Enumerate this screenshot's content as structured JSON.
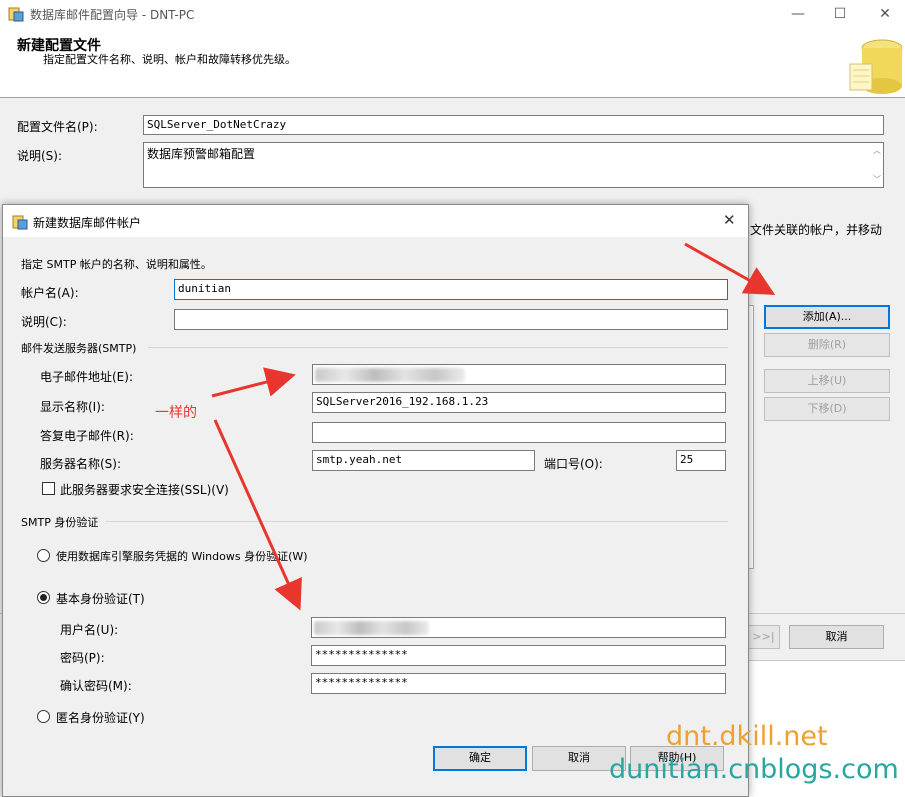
{
  "bg_window": {
    "title": "数据库邮件配置向导 - DNT-PC",
    "header_title": "新建配置文件",
    "header_subtitle": "指定配置文件名称、说明、帐户和故障转移优先级。",
    "profile_name_label": "配置文件名(P):",
    "profile_name_value": "SQLServer_DotNetCrazy",
    "description_label": "说明(S):",
    "description_value": "数据库预警邮箱配置",
    "accounts_text": "文件关联的帐户，并移动",
    "add_button": "添加(A)...",
    "remove_button": "删除(R)",
    "move_up_button": "上移(U)",
    "move_down_button": "下移(D)",
    "cancel_button": "取消",
    "next_button": ">>|"
  },
  "dialog": {
    "title": "新建数据库邮件帐户",
    "instruction": "指定 SMTP 帐户的名称、说明和属性。",
    "account_name_label": "帐户名(A):",
    "account_name_value": "dunitian",
    "description_label": "说明(C):",
    "description_value": "",
    "smtp_group": "邮件发送服务器(SMTP)",
    "email_label": "电子邮件地址(E):",
    "display_name_label": "显示名称(I):",
    "display_name_value": "SQLServer2016_192.168.1.23",
    "reply_email_label": "答复电子邮件(R):",
    "reply_email_value": "",
    "server_label": "服务器名称(S):",
    "server_value": "smtp.yeah.net",
    "port_label": "端口号(O):",
    "port_value": "25",
    "ssl_label": "此服务器要求安全连接(SSL)(V)",
    "auth_group": "SMTP 身份验证",
    "auth_windows_label": "使用数据库引擎服务凭据的 Windows 身份验证(W)",
    "auth_basic_label": "基本身份验证(T)",
    "username_label": "用户名(U):",
    "password_label": "密码(P):",
    "password_value": "**************",
    "confirm_password_label": "确认密码(M):",
    "confirm_password_value": "**************",
    "auth_anonymous_label": "匿名身份验证(Y)",
    "ok_button": "确定",
    "cancel_button": "取消",
    "help_button": "帮助(H)"
  },
  "annotation": {
    "text": "一样的",
    "color": "#e8352e"
  },
  "watermark": {
    "line1": "dnt.dkill.net",
    "line2": "dunitian.cnblogs.com",
    "color1": "#f0a030",
    "color2": "#2aa6a0"
  }
}
